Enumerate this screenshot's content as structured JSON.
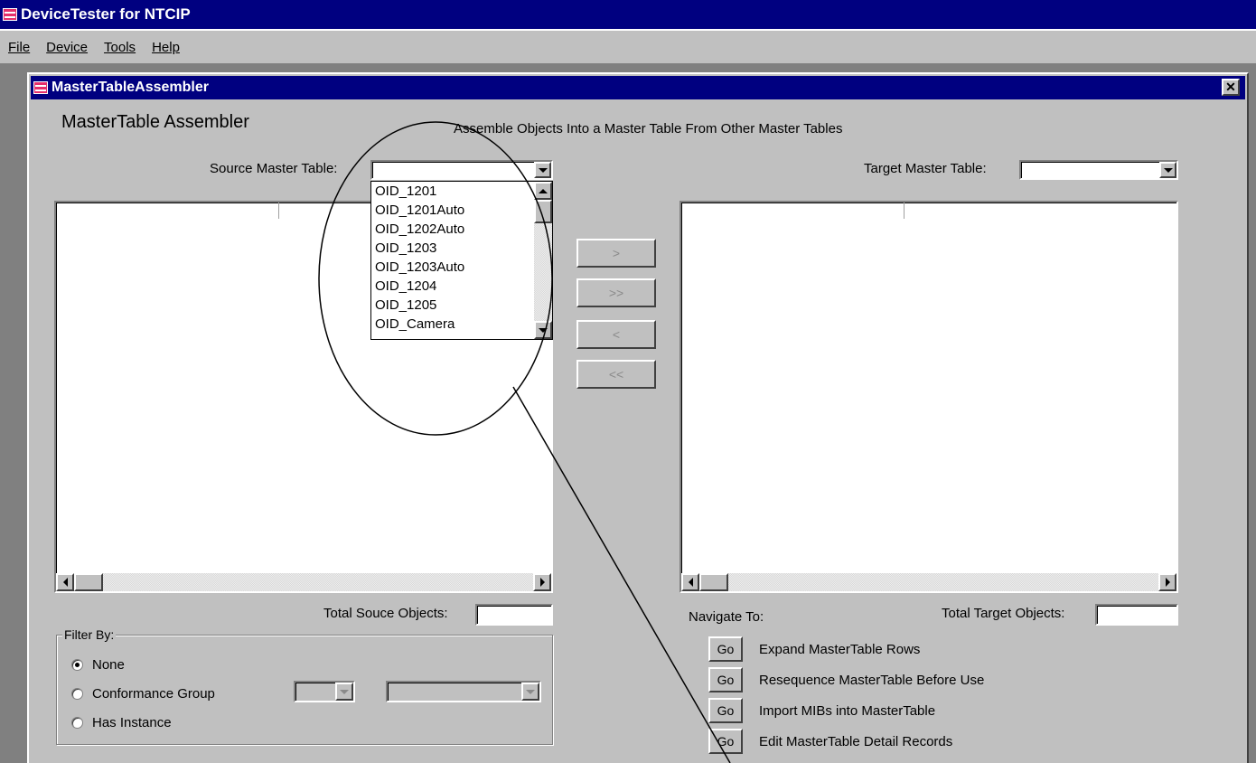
{
  "app": {
    "title": "DeviceTester for NTCIP",
    "menu": [
      "File",
      "Device",
      "Tools",
      "Help"
    ]
  },
  "window": {
    "title": "MasterTableAssembler",
    "heading": "MasterTable Assembler",
    "subtitle": "Assemble Objects Into a Master Table From Other Master Tables"
  },
  "source": {
    "label": "Source Master Table:",
    "value": "",
    "options": [
      "OID_1201",
      "OID_1201Auto",
      "OID_1202Auto",
      "OID_1203",
      "OID_1203Auto",
      "OID_1204",
      "OID_1205",
      "OID_Camera"
    ],
    "total_label": "Total Souce Objects:",
    "total_value": ""
  },
  "target": {
    "label": "Target Master Table:",
    "value": "",
    "total_label": "Total Target Objects:",
    "total_value": ""
  },
  "transfer_buttons": {
    "move_one": ">",
    "move_all": ">>",
    "remove_one": "<",
    "remove_all": "<<"
  },
  "filter": {
    "legend": "Filter By:",
    "options": [
      "None",
      "Conformance Group",
      "Has Instance"
    ],
    "selected": "None"
  },
  "navigate": {
    "label": "Navigate To:",
    "go_label": "Go",
    "items": [
      "Expand MasterTable Rows",
      "Resequence MasterTable Before Use",
      "Import MIBs into MasterTable",
      "Edit MasterTable Detail Records"
    ]
  },
  "colors": {
    "titlebar": "#000080",
    "face": "#c0c0c0",
    "desktop_strip": "#808080"
  }
}
